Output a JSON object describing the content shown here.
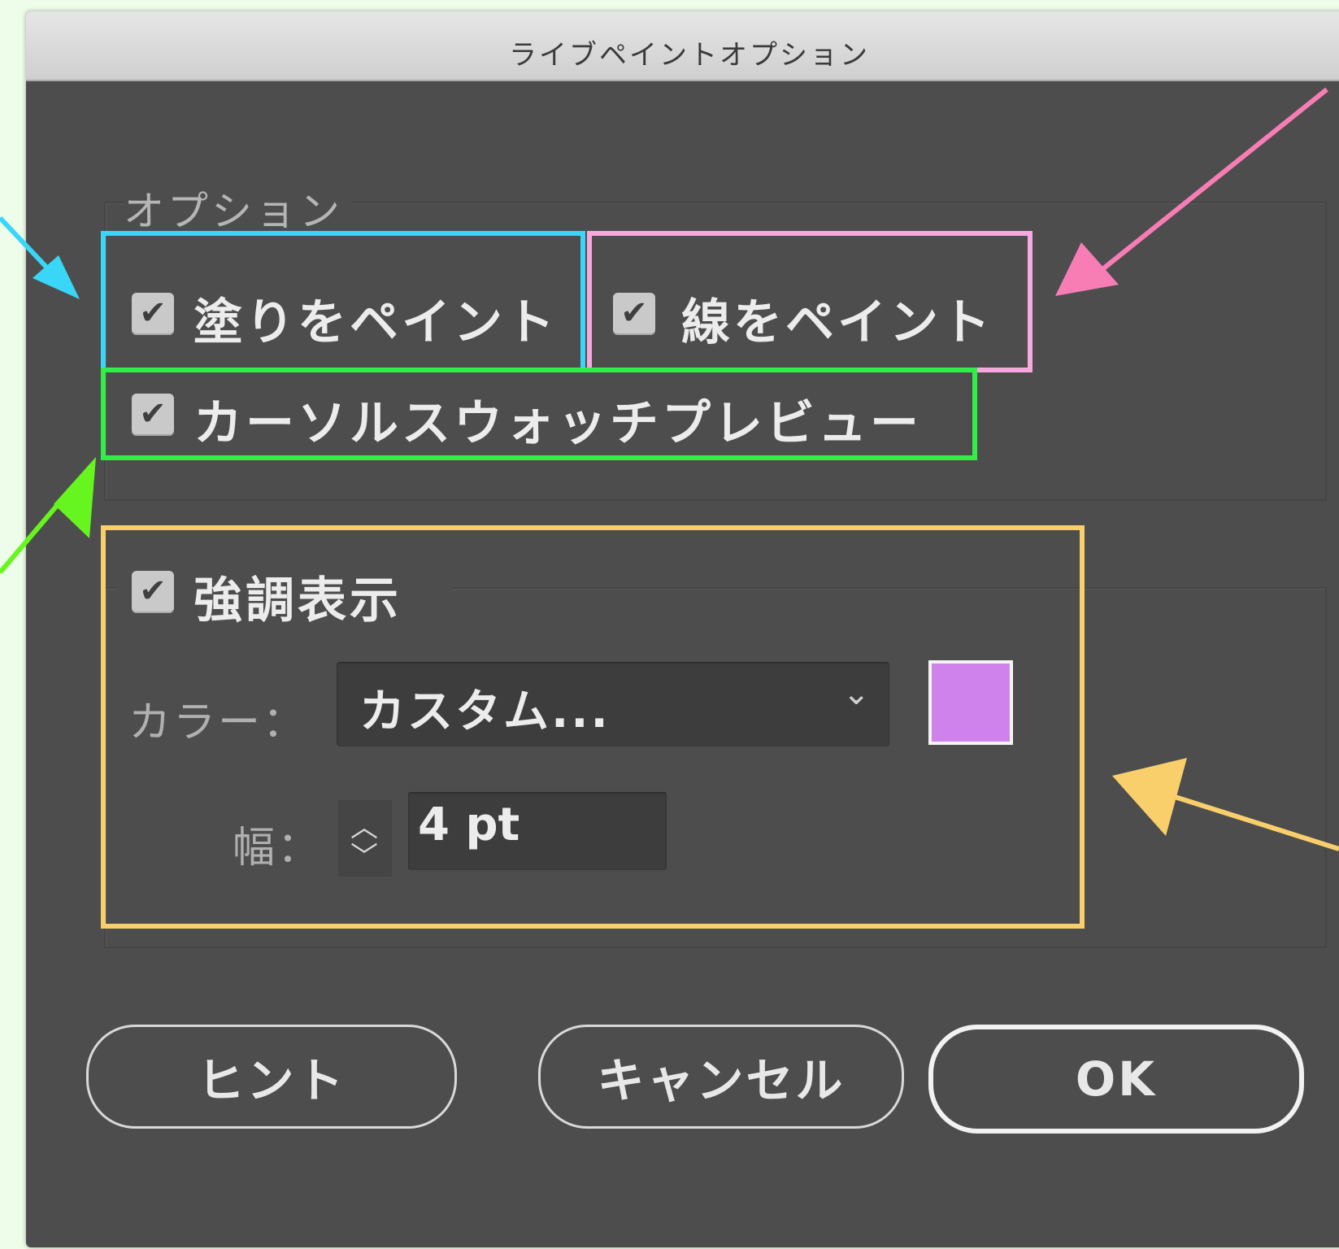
{
  "window": {
    "title": "ライブペイントオプション"
  },
  "options_section": {
    "label": "オプション",
    "fill_checkbox": {
      "label": "塗りをペイント",
      "checked": true,
      "mark": "✔"
    },
    "stroke_checkbox": {
      "label": "線をペイント",
      "checked": true,
      "mark": "✔"
    },
    "cursor_preview_checkbox": {
      "label": "カーソルスウォッチプレビュー",
      "checked": true,
      "mark": "✔"
    }
  },
  "highlight_section": {
    "checkbox": {
      "label": "強調表示",
      "checked": true,
      "mark": "✔"
    },
    "color_label": "カラー：",
    "color_select": {
      "value": "カスタム...",
      "chevron": "⌄"
    },
    "color_swatch": "#cf82ec",
    "width_label": "幅：",
    "width_stepper": {
      "up": "︿",
      "down": "﹀"
    },
    "width_value": "4 pt"
  },
  "buttons": {
    "hint": "ヒント",
    "cancel": "キャンセル",
    "ok": "OK"
  },
  "annotation_colors": {
    "blue": "#3ad6f7",
    "pink": "#f77db4",
    "pink_box": "#f7a9df",
    "green": "#33ee48",
    "green_arrow": "#66f51f",
    "yellow": "#f8cf6b"
  }
}
